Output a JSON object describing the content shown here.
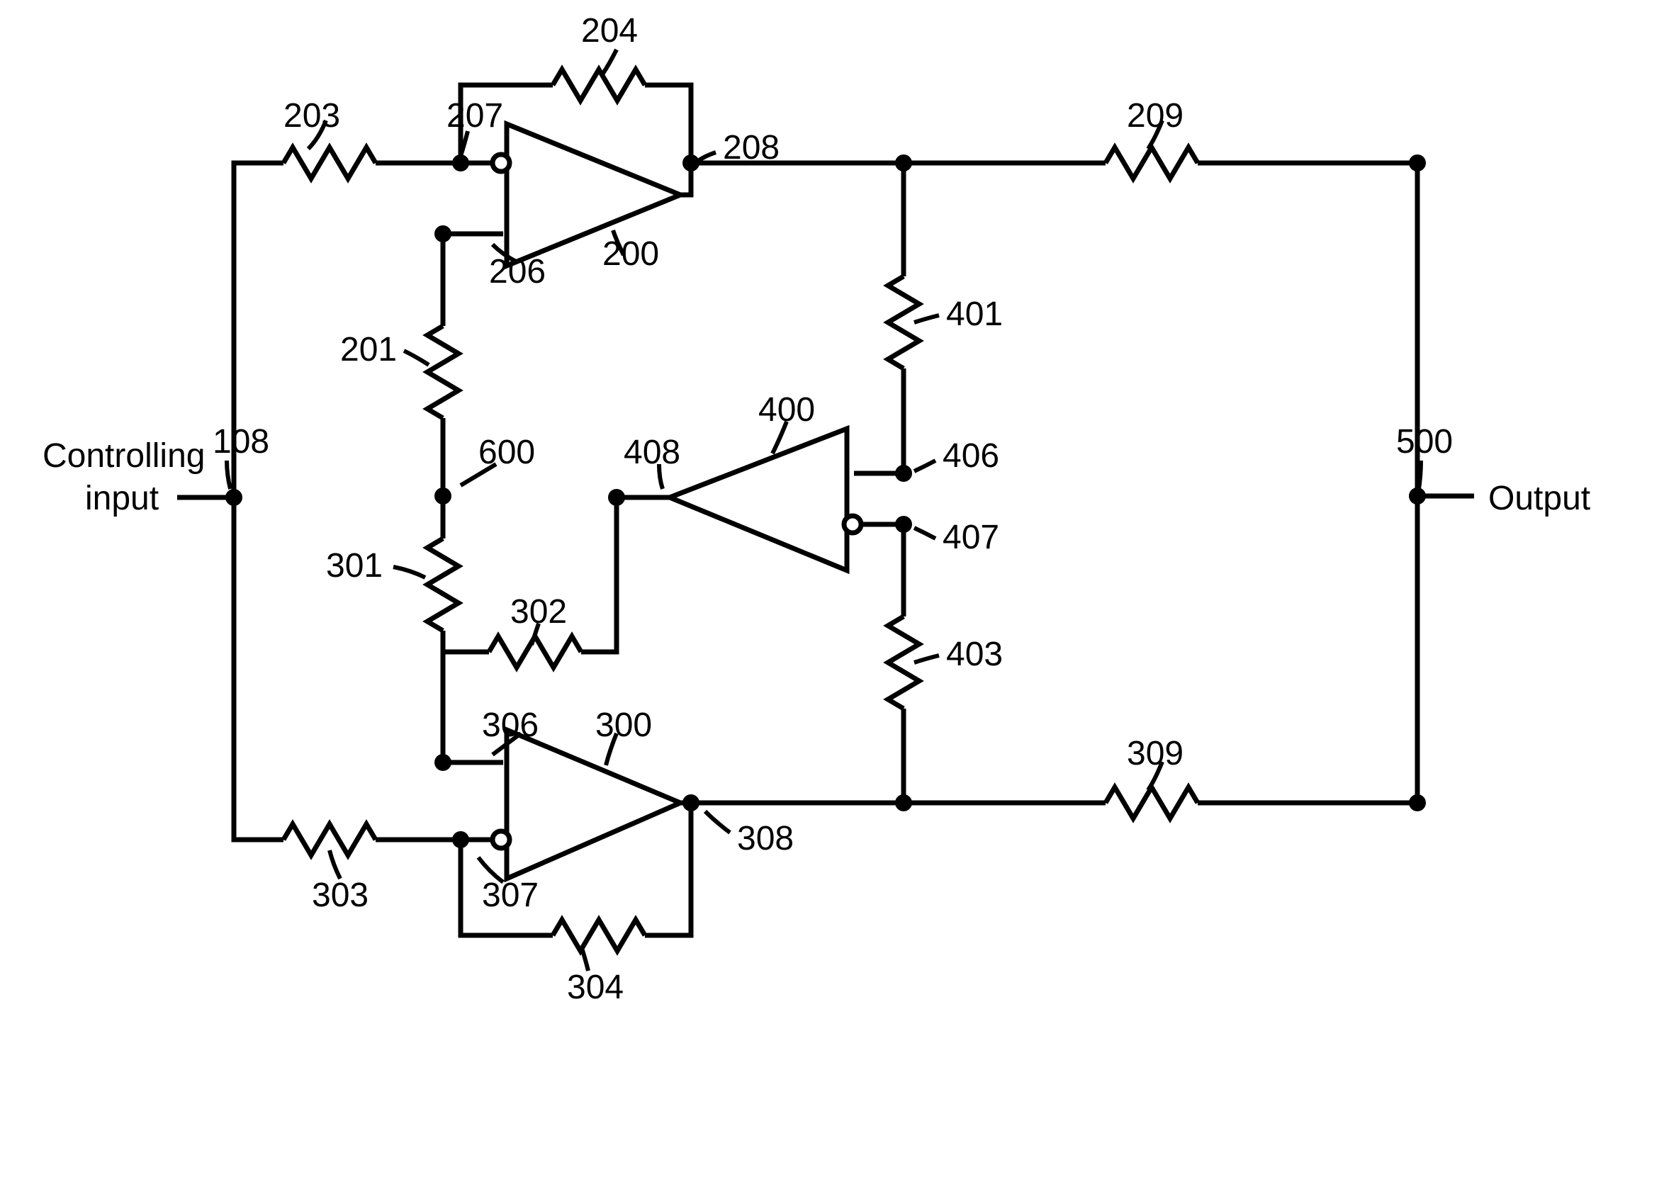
{
  "text": {
    "controlling_input_line1": "Controlling",
    "controlling_input_line2": "input",
    "output": "Output"
  },
  "refs": {
    "r108": "108",
    "r200": "200",
    "r201": "201",
    "r203": "203",
    "r204": "204",
    "r206": "206",
    "r207": "207",
    "r208": "208",
    "r209": "209",
    "r300": "300",
    "r301": "301",
    "r302": "302",
    "r303": "303",
    "r304": "304",
    "r306": "306",
    "r307": "307",
    "r308": "308",
    "r309": "309",
    "r400": "400",
    "r401": "401",
    "r403": "403",
    "r406": "406",
    "r407": "407",
    "r408": "408",
    "r500": "500",
    "r600": "600"
  }
}
